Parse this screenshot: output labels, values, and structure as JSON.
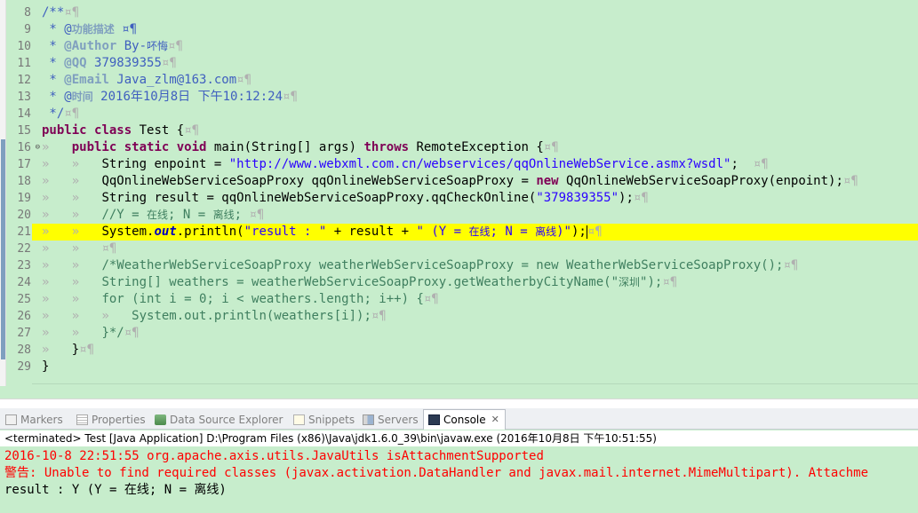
{
  "editor": {
    "line_numbers": [
      "8",
      "9",
      "10",
      "11",
      "12",
      "13",
      "14",
      "15",
      "16",
      "17",
      "18",
      "19",
      "20",
      "21",
      "22",
      "23",
      "24",
      "25",
      "26",
      "27",
      "28",
      "29"
    ],
    "fold_markers": {
      "16": "⊖"
    },
    "l8": {
      "a": "/**",
      "b": "¤¶"
    },
    "l9": {
      "a": " * @",
      "b": "功能描述",
      "c": " ¤¶"
    },
    "l10": {
      "a": " * ",
      "b": "@Author",
      "c": " By-",
      "d": "吥悔",
      "e": "¤¶"
    },
    "l11": {
      "a": " * ",
      "b": "@QQ",
      "c": " 379839355",
      "d": "¤¶"
    },
    "l12": {
      "a": " * ",
      "b": "@Email",
      "c": " Java_zlm@163.com",
      "d": "¤¶"
    },
    "l13": {
      "a": " * @",
      "b": "时间",
      "c": " 2016年10月8日 下午10:12:24",
      "d": "¤¶"
    },
    "l14": {
      "a": " */",
      "b": "¤¶"
    },
    "l15": {
      "kw1": "public",
      "kw2": "class",
      "rest": " Test {",
      "ws": "¤¶"
    },
    "l16": {
      "ind": "»   ",
      "kw1": "public",
      "kw2": "static",
      "kw3": "void",
      "mid": " main(String[] args) ",
      "kw4": "throws",
      "rest": " RemoteException {",
      "ws": "¤¶"
    },
    "l17": {
      "ind": "»   »   ",
      "pre": "String enpoint = ",
      "str": "\"http://www.webxml.com.cn/webservices/qqOnlineWebService.asmx?wsdl\"",
      "post": ";  ",
      "ws": "¤¶"
    },
    "l18": {
      "ind": "»   »   ",
      "pre": "QqOnlineWebServiceSoapProxy qqOnlineWebServiceSoapProxy = ",
      "kw": "new",
      "post": " QqOnlineWebServiceSoapProxy(enpoint);",
      "ws": "¤¶"
    },
    "l19": {
      "ind": "»   »   ",
      "pre": "String result = qqOnlineWebServiceSoapProxy.qqCheckOnline(",
      "str": "\"379839355\"",
      "post": ");",
      "ws": "¤¶"
    },
    "l20": {
      "ind": "»   »   ",
      "cmt": "//Y = ",
      "zh1": "在线",
      "cmt2": "; N = ",
      "zh2": "离线",
      "cmt3": "; ",
      "ws": "¤¶"
    },
    "l21": {
      "ind": "»   »   ",
      "pre": "System.",
      "fld": "out",
      "mid": ".println(",
      "str1": "\"result : \"",
      "mid2": " + result + ",
      "str2a": "\" (Y = ",
      "zh1": "在线",
      "str2b": "; N = ",
      "zh2": "离线",
      "str2c": ")\"",
      "post": ");",
      "ws": "¤¶"
    },
    "l22": {
      "ind": "»   »   ",
      "ws": "¤¶"
    },
    "l23": {
      "ind": "»   »   ",
      "cmt": "/*WeatherWebServiceSoapProxy weatherWebServiceSoapProxy = new WeatherWebServiceSoapProxy();",
      "ws": "¤¶"
    },
    "l24": {
      "ind": "»   »   ",
      "cmt": "String[] weathers = weatherWebServiceSoapProxy.getWeatherbyCityName(\"",
      "zh": "深圳",
      "cmt2": "\");",
      "ws": "¤¶"
    },
    "l25": {
      "ind": "»   »   ",
      "cmt": "for (int i = 0; i < weathers.length; i++) {",
      "ws": "¤¶"
    },
    "l26": {
      "ind": "»   »   »   ",
      "cmt": "System.out.println(weathers[i]);",
      "ws": "¤¶"
    },
    "l27": {
      "ind": "»   »   ",
      "cmt": "}*/",
      "ws": "¤¶"
    },
    "l28": {
      "ind": "»   ",
      "rest": "}",
      "ws": "¤¶"
    },
    "l29": {
      "rest": "}"
    }
  },
  "scroll": {
    "left_arrow": "◂"
  },
  "tabs": [
    {
      "label": "Markers",
      "icon": "markers-icon"
    },
    {
      "label": "Properties",
      "icon": "properties-icon"
    },
    {
      "label": "Data Source Explorer",
      "icon": "data-source-explorer-icon"
    },
    {
      "label": "Snippets",
      "icon": "snippets-icon"
    },
    {
      "label": "Servers",
      "icon": "servers-icon"
    },
    {
      "label": "Console",
      "icon": "console-icon",
      "active": true,
      "close": "✕"
    }
  ],
  "console": {
    "status": "<terminated> Test [Java Application] D:\\Program Files (x86)\\Java\\jdk1.6.0_39\\bin\\javaw.exe (2016年10月8日 下午10:51:55)",
    "lines": [
      {
        "text": "2016-10-8 22:51:55 org.apache.axis.utils.JavaUtils isAttachmentSupported",
        "kind": "err"
      },
      {
        "text": "警告: Unable to find required classes (javax.activation.DataHandler and javax.mail.internet.MimeMultipart). Attachme",
        "kind": "err"
      },
      {
        "text": "result : Y (Y = 在线; N = 离线)",
        "kind": "out"
      }
    ]
  },
  "colors": {
    "background": "#c7edcc",
    "keyword": "#7f0055",
    "string": "#2a00ff",
    "comment": "#3f7f5f",
    "javadoc": "#3f5fbf",
    "current_line": "#ffff00",
    "stderr": "#ff0000"
  }
}
